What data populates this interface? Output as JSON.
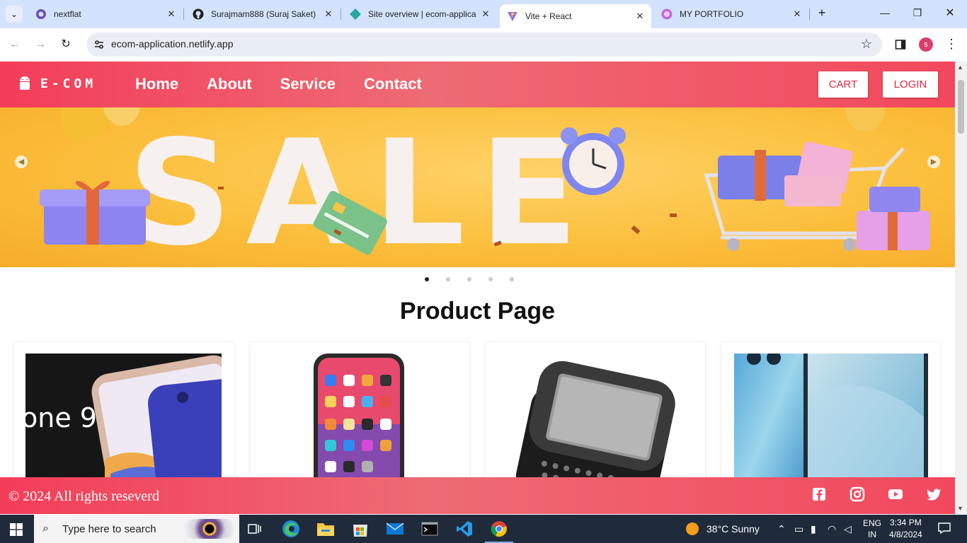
{
  "browser": {
    "tabs": [
      {
        "title": "nextflat",
        "active": false
      },
      {
        "title": "Surajmam888 (Suraj Saket)",
        "active": false
      },
      {
        "title": "Site overview | ecom-applica",
        "active": false
      },
      {
        "title": "Vite + React",
        "active": true
      },
      {
        "title": "MY PORTFOLIO",
        "active": false
      }
    ],
    "url": "ecom-application.netlify.app",
    "profile_initial": "s"
  },
  "site": {
    "logo_text": "E-COM",
    "nav": [
      "Home",
      "About",
      "Service",
      "Contact"
    ],
    "cart_label": "CART",
    "login_label": "LOGIN",
    "banner": {
      "word": "SALE",
      "slides": 5,
      "active_slide": 1
    },
    "page_title": "Product Page",
    "products": [
      {
        "image": "iphone-9-banner"
      },
      {
        "image": "iphone-homescreen"
      },
      {
        "image": "slider-phone-keyboard"
      },
      {
        "image": "blue-smartphone"
      }
    ],
    "footer_text": "© 2024 All rights reseverd",
    "social_icons": [
      "facebook-icon",
      "instagram-icon",
      "youtube-icon",
      "twitter-icon"
    ],
    "accent_color": "#f33d59"
  },
  "taskbar": {
    "search_placeholder": "Type here to search",
    "weather": "38°C  Sunny",
    "lang_top": "ENG",
    "lang_bottom": "IN",
    "time": "3:34 PM",
    "date": "4/8/2024"
  }
}
